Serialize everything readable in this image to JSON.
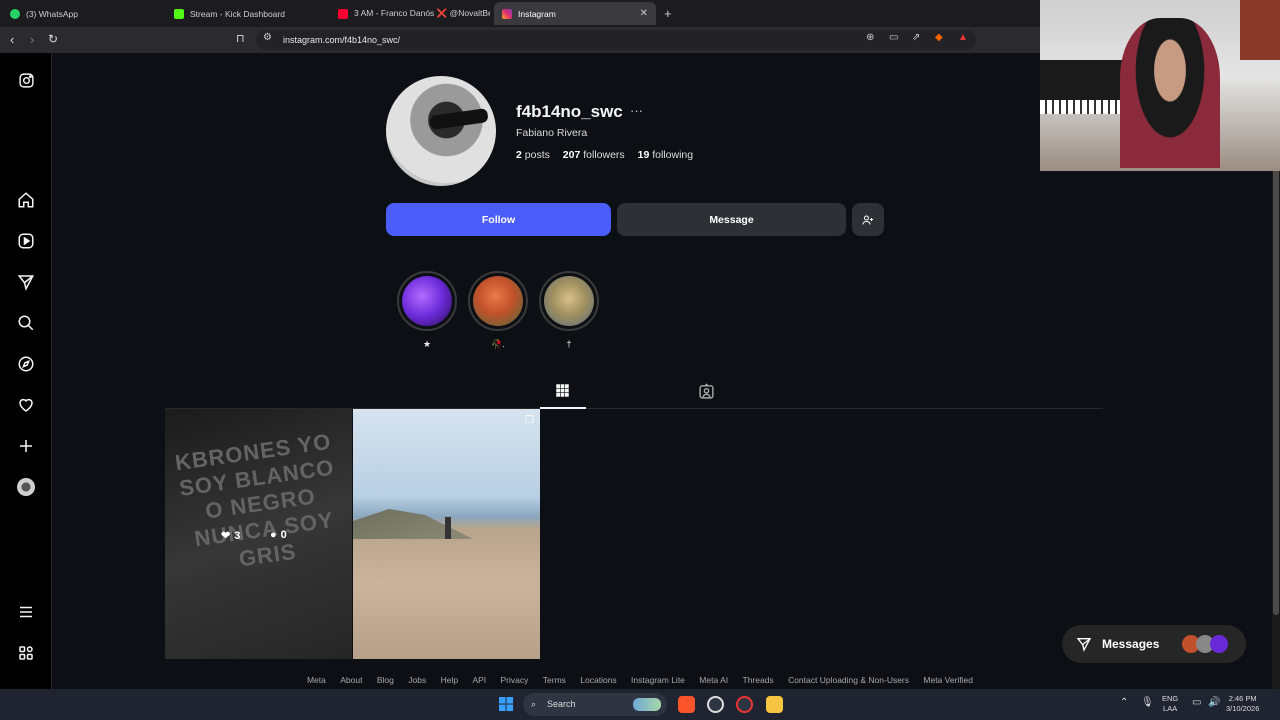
{
  "browser": {
    "tabs": [
      {
        "label": "(3) WhatsApp",
        "favicon_color": "#25d366"
      },
      {
        "label": "Stream - Kick Dashboard",
        "favicon_color": "#53fc18"
      },
      {
        "label": "3 AM - Franco Danós ❌ @NovaltBe",
        "favicon_color": "#ff0033"
      },
      {
        "label": "Instagram",
        "favicon_color": "#e1306c"
      }
    ],
    "url": "instagram.com/f4b14no_swc/"
  },
  "sidebar": {
    "icons": [
      "instagram-icon",
      "home-icon",
      "reels-icon",
      "direct-icon",
      "search-icon",
      "explore-icon",
      "heart-icon",
      "create-icon",
      "profile-avatar",
      "menu-icon",
      "apps-icon"
    ]
  },
  "profile": {
    "username": "f4b14no_swc",
    "more": "···",
    "full_name": "Fabiano Rivera",
    "posts_count": "2",
    "posts_label": "posts",
    "followers_count": "207",
    "followers_label": "followers",
    "following_count": "19",
    "following_label": "following"
  },
  "actions": {
    "follow_label": "Follow",
    "message_label": "Message"
  },
  "highlights": [
    {
      "label": "★",
      "color": "#6a2ad8"
    },
    {
      "label": "🥀.",
      "color": "#c0512b"
    },
    {
      "label": "†",
      "color": "#a09060"
    }
  ],
  "posts": [
    {
      "likes": "3",
      "comments": "0",
      "text": "KBRONES YO SOY BLANCO O NEGRO NUNCA SOY GRIS"
    },
    {
      "likes": "",
      "comments": ""
    }
  ],
  "footer": {
    "links": [
      "Meta",
      "About",
      "Blog",
      "Jobs",
      "Help",
      "API",
      "Privacy",
      "Terms",
      "Locations",
      "Instagram Lite",
      "Meta AI",
      "Threads",
      "Contact Uploading & Non-Users",
      "Meta Verified"
    ]
  },
  "messages_pill": {
    "label": "Messages"
  },
  "taskbar": {
    "search_label": "Search",
    "lang": "ENG",
    "lang2": "LAA",
    "time": "2:46 PM",
    "date": "3/10/2026"
  }
}
